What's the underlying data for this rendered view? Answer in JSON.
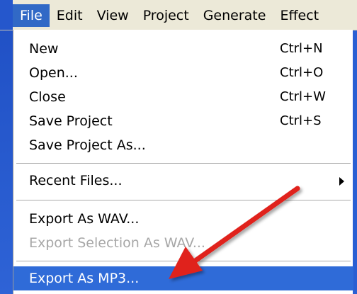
{
  "menubar": {
    "items": [
      {
        "label": "File",
        "active": true
      },
      {
        "label": "Edit"
      },
      {
        "label": "View"
      },
      {
        "label": "Project"
      },
      {
        "label": "Generate"
      },
      {
        "label": "Effect"
      }
    ]
  },
  "file_menu": {
    "new": {
      "label": "New",
      "shortcut": "Ctrl+N"
    },
    "open": {
      "label": "Open...",
      "shortcut": "Ctrl+O"
    },
    "close": {
      "label": "Close",
      "shortcut": "Ctrl+W"
    },
    "save_project": {
      "label": "Save Project",
      "shortcut": "Ctrl+S"
    },
    "save_project_as": {
      "label": "Save Project As..."
    },
    "recent_files": {
      "label": "Recent Files...",
      "icon": "submenu-arrow-icon"
    },
    "export_wav": {
      "label": "Export As WAV..."
    },
    "export_selection_wav": {
      "label": "Export Selection As WAV...",
      "state": "disabled"
    },
    "export_mp3": {
      "label": "Export As MP3...",
      "state": "highlighted"
    }
  },
  "colors": {
    "frame_blue": "#2557cc",
    "highlight_blue": "#2f6bd8",
    "annotation_red": "#e0201b",
    "disabled_text": "#a7a7a7"
  }
}
